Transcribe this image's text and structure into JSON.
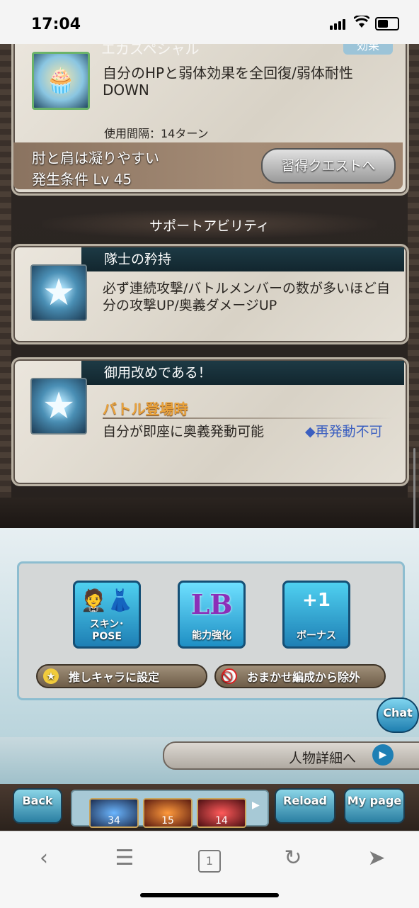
{
  "status_bar": {
    "time": "17:04"
  },
  "skill_panel": {
    "partial_title": "エカスペシャル",
    "tag": "効果",
    "effect": "自分のHPと弱体効果を全回復/弱体耐性DOWN",
    "cooldown": "使用間隔：14ターン",
    "unlock_name": "肘と肩は凝りやすい",
    "unlock_condition": "発生条件 Lv 45",
    "quest_button": "習得クエストへ"
  },
  "support_section": {
    "heading": "サポートアビリティ",
    "abilities": [
      {
        "name": "隊士の矜持",
        "description": "必ず連続攻撃/バトルメンバーの数が多いほど自分の攻撃UP/奥義ダメージUP"
      },
      {
        "name": "御用改めである！",
        "trigger": "バトル登場時",
        "description": "自分が即座に奥義発動可能",
        "note": "◆再発動不可"
      }
    ]
  },
  "menu": {
    "buttons": [
      {
        "label": "スキン･POSE",
        "icon": "outfit-icon"
      },
      {
        "label": "能力強化",
        "icon_text": "LB"
      },
      {
        "label": "ボーナス",
        "icon_text": "+1"
      }
    ],
    "favorite": "推しキャラに設定",
    "exclude": "おまかせ編成から除外",
    "chat": "Chat",
    "detail_link": "人物詳細へ"
  },
  "game_nav": {
    "back": "Back",
    "items": [
      "34",
      "15",
      "14"
    ],
    "reload": "Reload",
    "mypage": "My page"
  },
  "safari": {
    "tab_count": "1"
  },
  "colors": {
    "accent_blue": "#1e7fb4",
    "trigger_orange": "#e9a23b",
    "note_blue": "#3b5fc0"
  }
}
